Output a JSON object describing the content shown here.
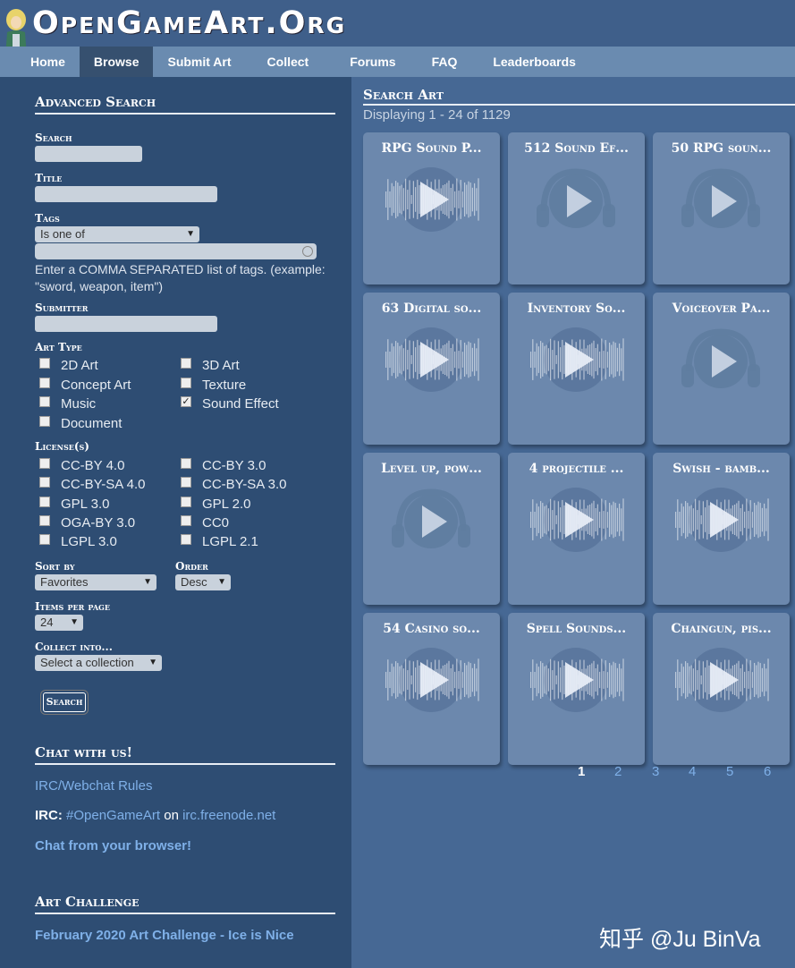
{
  "site": {
    "logo_text": "OpenGameArt.Org"
  },
  "nav": [
    {
      "label": "Home"
    },
    {
      "label": "Browse",
      "active": true
    },
    {
      "label": "Submit Art"
    },
    {
      "label": "Collect"
    },
    {
      "label": "Forums"
    },
    {
      "label": "FAQ"
    },
    {
      "label": "Leaderboards"
    }
  ],
  "sidebar": {
    "advanced_title": "Advanced Search",
    "search_label": "Search",
    "title_label": "Title",
    "tags_label": "Tags",
    "tags_mode": "Is one of",
    "tags_help": "Enter a COMMA SEPARATED list of tags. (example: \"sword, weapon, item\")",
    "submitter_label": "Submitter",
    "art_type_label": "Art Type",
    "art_types": [
      {
        "label": "2D Art",
        "checked": false
      },
      {
        "label": "3D Art",
        "checked": false
      },
      {
        "label": "Concept Art",
        "checked": false
      },
      {
        "label": "Texture",
        "checked": false
      },
      {
        "label": "Music",
        "checked": false
      },
      {
        "label": "Sound Effect",
        "checked": true
      },
      {
        "label": "Document",
        "checked": false
      }
    ],
    "license_label": "License(s)",
    "licenses": [
      {
        "label": "CC-BY 4.0"
      },
      {
        "label": "CC-BY 3.0"
      },
      {
        "label": "CC-BY-SA 4.0"
      },
      {
        "label": "CC-BY-SA 3.0"
      },
      {
        "label": "GPL 3.0"
      },
      {
        "label": "GPL 2.0"
      },
      {
        "label": "OGA-BY 3.0"
      },
      {
        "label": "CC0"
      },
      {
        "label": "LGPL 3.0"
      },
      {
        "label": "LGPL 2.1"
      }
    ],
    "sort_by_label": "Sort by",
    "sort_by_value": "Favorites",
    "order_label": "Order",
    "order_value": "Desc",
    "items_per_page_label": "Items per page",
    "items_per_page_value": "24",
    "collect_into_label": "Collect into...",
    "collect_into_value": "Select a collection",
    "search_button": "Search",
    "chat_title": "Chat with us!",
    "irc_rules_link": "IRC/Webchat Rules",
    "irc_prefix": "IRC:",
    "irc_channel": "#OpenGameArt",
    "irc_on": "on",
    "irc_server": "irc.freenode.net",
    "chat_browser_link": "Chat from your browser!",
    "challenge_title": "Art Challenge",
    "challenge_link": "February 2020 Art Challenge - Ice is Nice"
  },
  "main": {
    "title": "Search Art",
    "displaying": "Displaying 1 - 24 of 1129",
    "cards": [
      {
        "title": "RPG Sound P...",
        "icon": "waveform-play-icon"
      },
      {
        "title": "512 Sound Ef...",
        "icon": "headphones-play-icon"
      },
      {
        "title": "50 RPG soun...",
        "icon": "headphones-play-icon"
      },
      {
        "title": "63 Digital so...",
        "icon": "waveform-play-icon"
      },
      {
        "title": "Inventory So...",
        "icon": "waveform-play-icon"
      },
      {
        "title": "Voiceover Pa...",
        "icon": "headphones-play-icon"
      },
      {
        "title": "Level up, pow...",
        "icon": "headphones-play-icon"
      },
      {
        "title": "4 projectile ...",
        "icon": "waveform-play-icon"
      },
      {
        "title": "Swish - bamb...",
        "icon": "waveform-play-icon"
      },
      {
        "title": "54 Casino so...",
        "icon": "waveform-play-icon"
      },
      {
        "title": "Spell Sounds...",
        "icon": "waveform-play-icon"
      },
      {
        "title": "Chaingun, pis...",
        "icon": "waveform-play-icon"
      }
    ],
    "pages": [
      "1",
      "2",
      "3",
      "4",
      "5",
      "6"
    ],
    "current_page": "1"
  },
  "watermark": "知乎 @Ju BinVa"
}
